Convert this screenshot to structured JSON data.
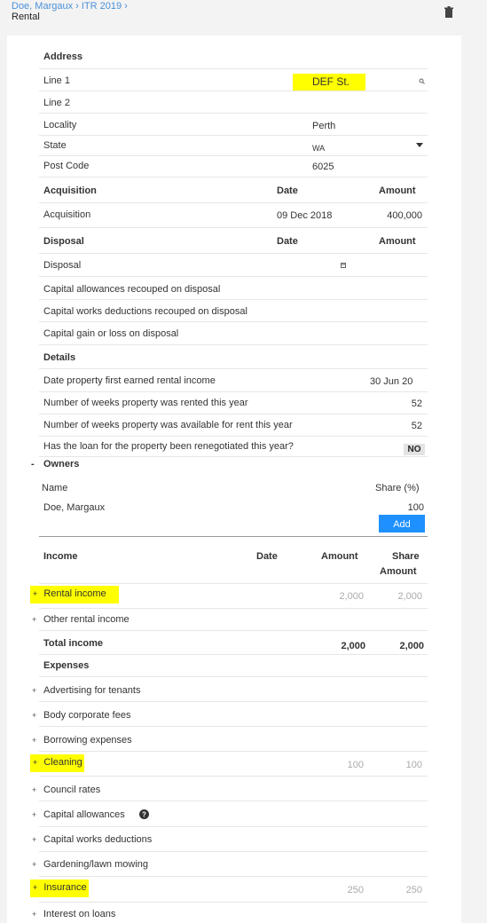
{
  "header": {
    "breadcrumb": "Doe, Margaux › ITR 2019 ›",
    "title": "Rental"
  },
  "address": {
    "heading": "Address",
    "line1_label": "Line 1",
    "line1_value": "DEF St.",
    "line2_label": "Line 2",
    "locality_label": "Locality",
    "locality_value": "Perth",
    "state_label": "State",
    "state_value": "WA",
    "postcode_label": "Post Code",
    "postcode_value": "6025"
  },
  "acquisition": {
    "heading": "Acquisition",
    "date_col": "Date",
    "amount_col": "Amount",
    "row_label": "Acquisition",
    "row_date": "09 Dec 2018",
    "row_amount": "400,000"
  },
  "disposal": {
    "heading": "Disposal",
    "date_col": "Date",
    "amount_col": "Amount",
    "rows": [
      "Disposal",
      "Capital allowances recouped on disposal",
      "Capital works deductions recouped on disposal",
      "Capital gain or loss on disposal"
    ]
  },
  "details": {
    "heading": "Details",
    "rows": [
      {
        "label": "Date property first earned rental income",
        "value": "30 Jun 20"
      },
      {
        "label": "Number of weeks property was rented this year",
        "value": "52"
      },
      {
        "label": "Number of weeks property was available for rent this year",
        "value": "52"
      },
      {
        "label": "Has the loan for the property been renegotiated this year?",
        "value": "NO"
      }
    ]
  },
  "owners": {
    "toggle": "-",
    "heading": "Owners",
    "name_col": "Name",
    "share_col": "Share (%)",
    "owner_name": "Doe, Margaux",
    "owner_share": "100",
    "add_label": "Add"
  },
  "income": {
    "heading": "Income",
    "date_col": "Date",
    "amount_col": "Amount",
    "share_col_1": "Share",
    "share_col_2": "Amount",
    "rows": [
      {
        "label": "Rental income",
        "amount": "2,000",
        "share": "2,000"
      },
      {
        "label": "Other rental income",
        "amount": "",
        "share": ""
      }
    ],
    "total_label": "Total income",
    "total_amount": "2,000",
    "total_share": "2,000"
  },
  "expenses": {
    "heading": "Expenses",
    "rows": [
      {
        "label": "Advertising for tenants",
        "amount": "",
        "share": ""
      },
      {
        "label": "Body corporate fees",
        "amount": "",
        "share": ""
      },
      {
        "label": "Borrowing expenses",
        "amount": "",
        "share": ""
      },
      {
        "label": "Cleaning",
        "amount": "100",
        "share": "100"
      },
      {
        "label": "Council rates",
        "amount": "",
        "share": ""
      },
      {
        "label": "Capital allowances",
        "amount": "",
        "share": ""
      },
      {
        "label": "Capital works deductions",
        "amount": "",
        "share": ""
      },
      {
        "label": "Gardening/lawn mowing",
        "amount": "",
        "share": ""
      },
      {
        "label": "Insurance",
        "amount": "250",
        "share": "250"
      },
      {
        "label": "Interest on loans",
        "amount": "",
        "share": ""
      }
    ]
  },
  "plus_symbol": "+",
  "colors": {
    "highlight": "#ffff00",
    "accent": "#1e90ff",
    "link": "#4a90d9"
  }
}
